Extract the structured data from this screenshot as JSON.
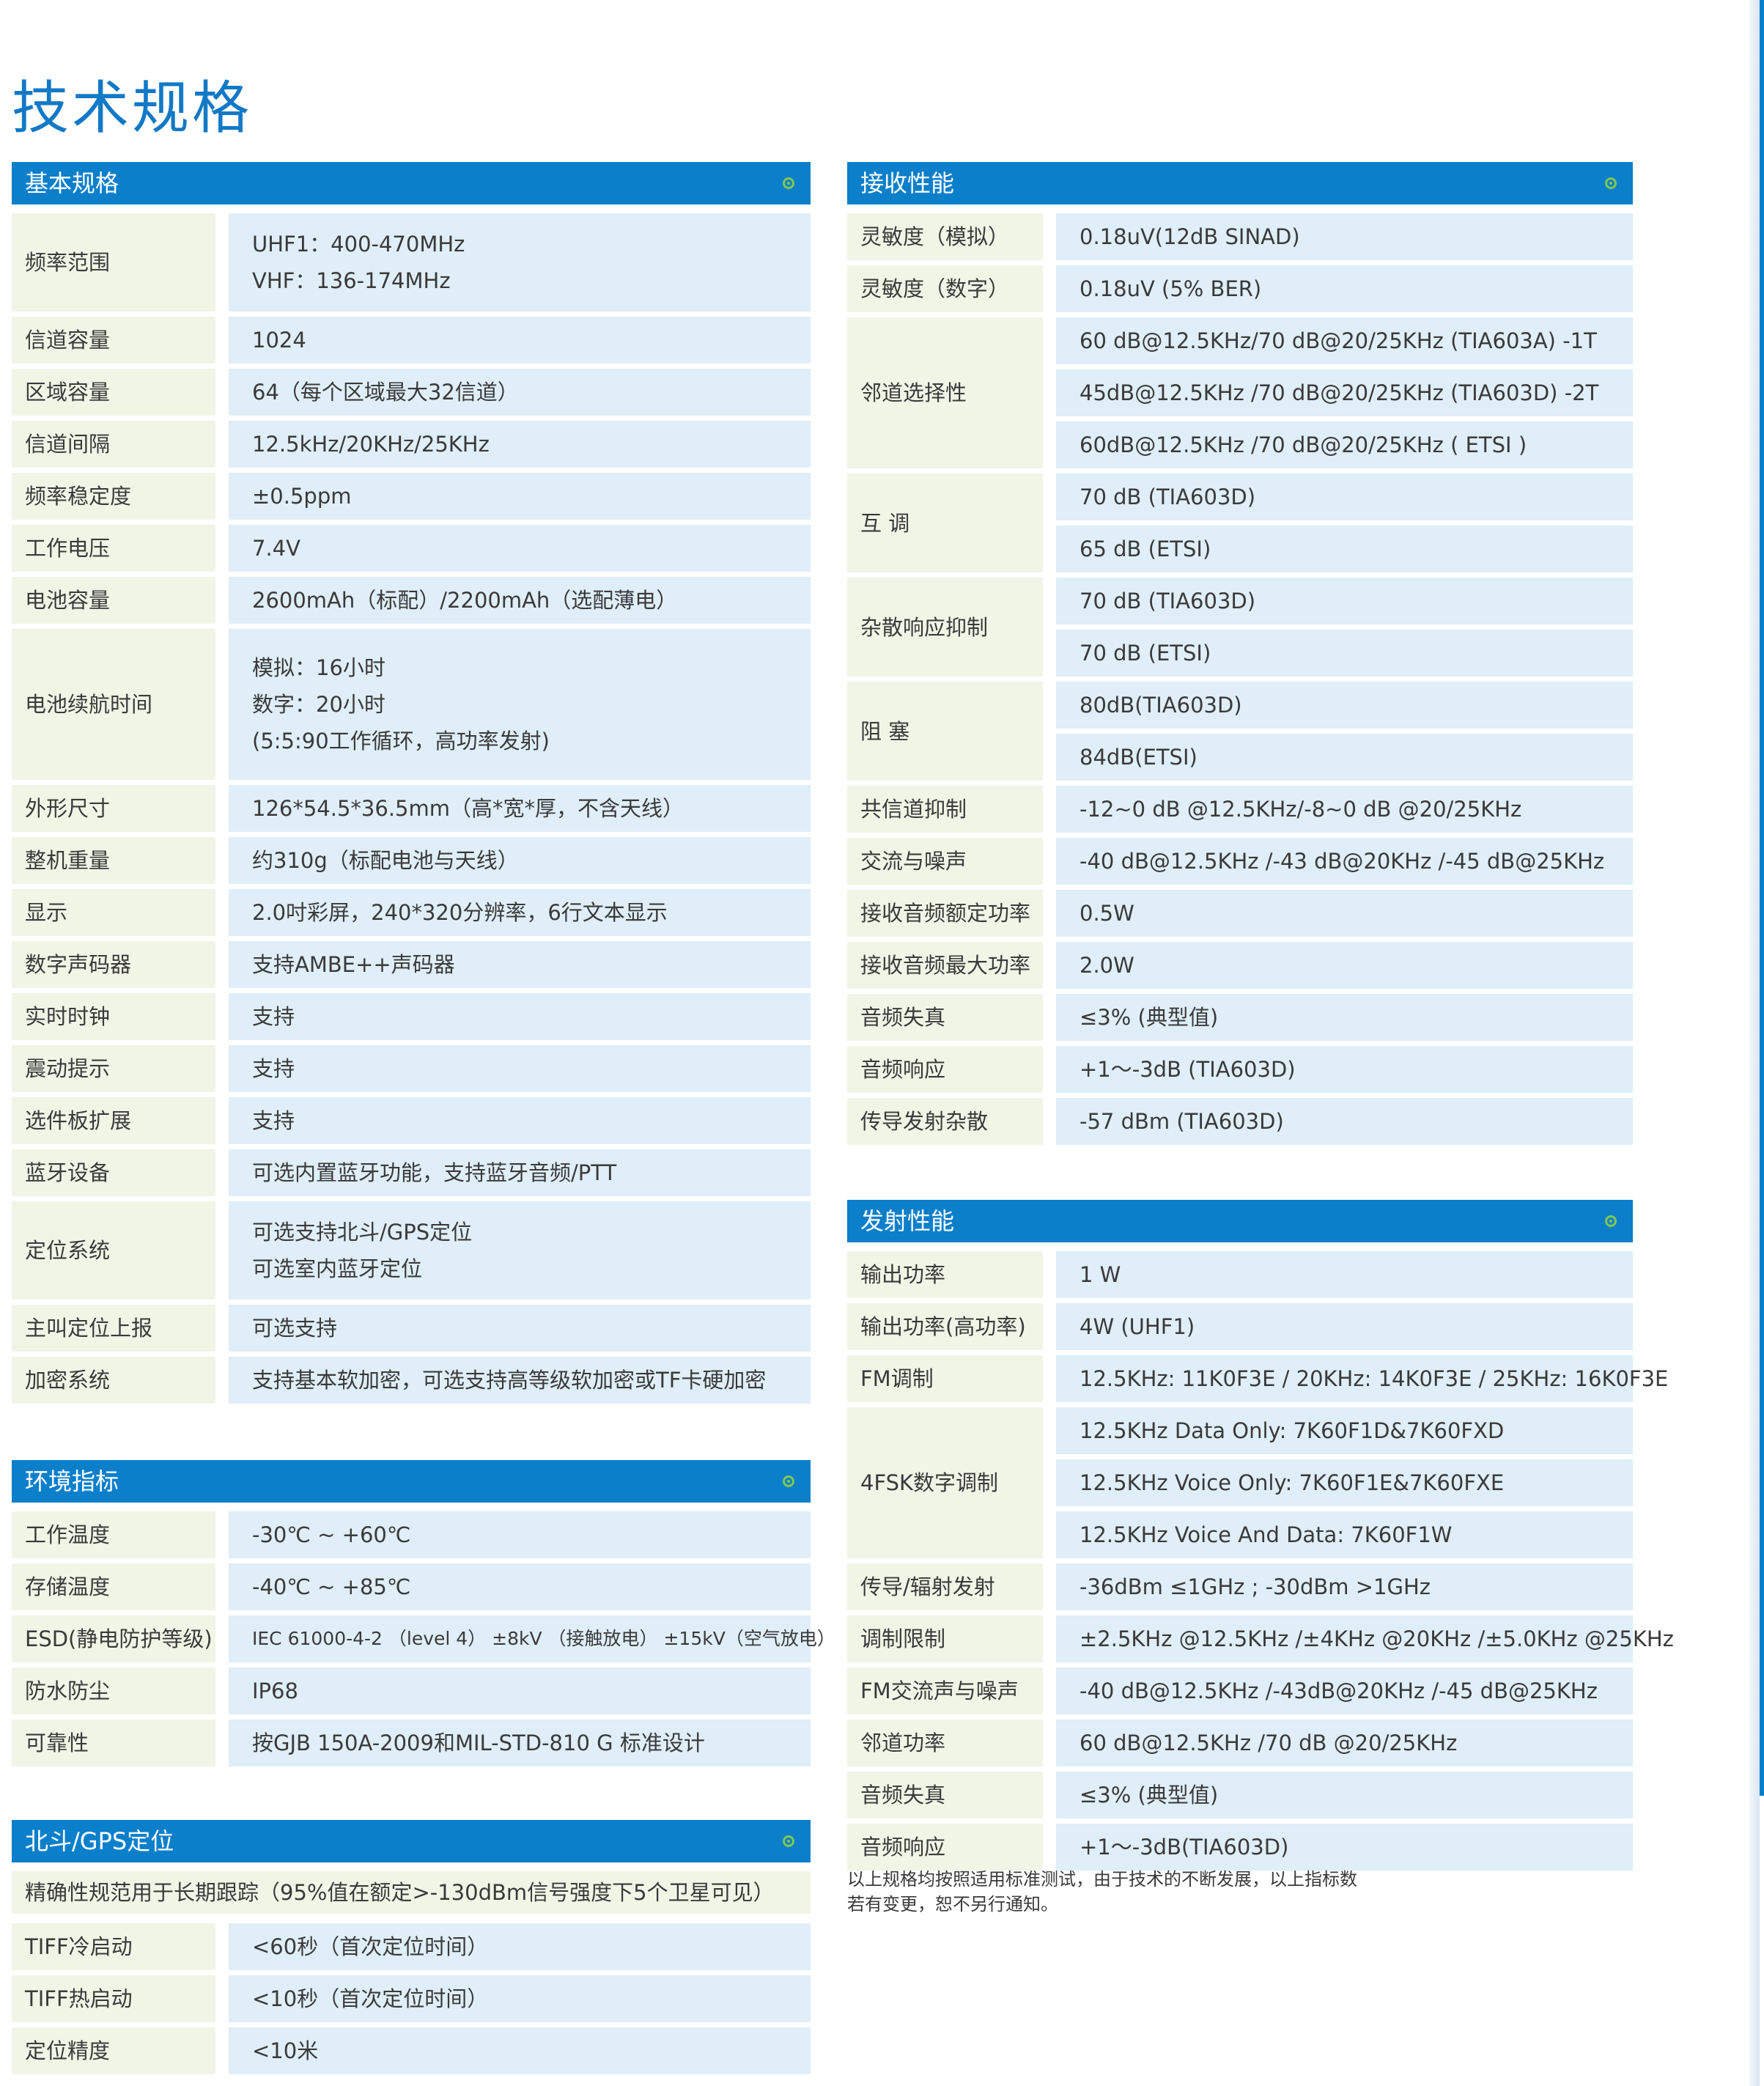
{
  "title": "技术规格",
  "colors": {
    "header": "#0c7fcb",
    "label_bg": "#f1f5e6",
    "value_bg": "#dfeef8",
    "title": "#1279c6"
  },
  "basic": {
    "heading": "基本规格",
    "rows": [
      {
        "label": "频率范围",
        "value": [
          "UHF1：400-470MHz",
          "VHF：136-174MHz"
        ]
      },
      {
        "label": "信道容量",
        "value": [
          "1024"
        ]
      },
      {
        "label": "区域容量",
        "value": [
          "64（每个区域最大32信道）"
        ]
      },
      {
        "label": "信道间隔",
        "value": [
          "12.5kHz/20KHz/25KHz"
        ]
      },
      {
        "label": "频率稳定度",
        "value": [
          "±0.5ppm"
        ]
      },
      {
        "label": "工作电压",
        "value": [
          "7.4V"
        ]
      },
      {
        "label": "电池容量",
        "value": [
          "2600mAh（标配）/2200mAh（选配薄电）"
        ]
      },
      {
        "label": "电池续航时间",
        "value": [
          "模拟：16小时",
          "数字：20小时",
          "(5:5:90工作循环，高功率发射)"
        ]
      },
      {
        "label": "外形尺寸",
        "value": [
          "126*54.5*36.5mm（高*宽*厚，不含天线）"
        ]
      },
      {
        "label": "整机重量",
        "value": [
          "约310g（标配电池与天线）"
        ]
      },
      {
        "label": "显示",
        "value": [
          "2.0吋彩屏，240*320分辨率，6行文本显示"
        ]
      },
      {
        "label": "数字声码器",
        "value": [
          "支持AMBE++声码器"
        ]
      },
      {
        "label": "实时时钟",
        "value": [
          "支持"
        ]
      },
      {
        "label": "震动提示",
        "value": [
          "支持"
        ]
      },
      {
        "label": "选件板扩展",
        "value": [
          "支持"
        ]
      },
      {
        "label": "蓝牙设备",
        "value": [
          "可选内置蓝牙功能，支持蓝牙音频/PTT"
        ]
      },
      {
        "label": "定位系统",
        "value": [
          "可选支持北斗/GPS定位",
          "可选室内蓝牙定位"
        ]
      },
      {
        "label": "主叫定位上报",
        "value": [
          "可选支持"
        ]
      },
      {
        "label": "加密系统",
        "value": [
          "支持基本软加密，可选支持高等级软加密或TF卡硬加密"
        ]
      }
    ]
  },
  "env": {
    "heading": "环境指标",
    "rows": [
      {
        "label": "工作温度",
        "value": [
          "-30℃ ~ +60℃"
        ]
      },
      {
        "label": "存储温度",
        "value": [
          "-40℃ ~ +85℃"
        ]
      },
      {
        "label": "ESD(静电防护等级)",
        "value": [
          "IEC 61000-4-2 （level 4） ±8kV （接触放电） ±15kV（空气放电）"
        ]
      },
      {
        "label": "防水防尘",
        "value": [
          "IP68"
        ]
      },
      {
        "label": "可靠性",
        "value": [
          "按GJB 150A-2009和MIL-STD-810 G 标准设计"
        ]
      }
    ]
  },
  "gps": {
    "heading": "北斗/GPS定位",
    "note": "精确性规范用于长期跟踪（95%值在额定>-130dBm信号强度下5个卫星可见）",
    "rows": [
      {
        "label": "TIFF冷启动",
        "value": [
          "<60秒（首次定位时间）"
        ]
      },
      {
        "label": "TIFF热启动",
        "value": [
          "<10秒（首次定位时间）"
        ]
      },
      {
        "label": "定位精度",
        "value": [
          "<10米"
        ]
      }
    ]
  },
  "receive": {
    "heading": "接收性能",
    "rows": [
      {
        "label": "灵敏度（模拟）",
        "value": [
          "0.18uV(12dB SINAD)"
        ]
      },
      {
        "label": "灵敏度（数字）",
        "value": [
          "0.18uV (5% BER)"
        ]
      },
      {
        "label": "邻道选择性",
        "value": [
          "60 dB@12.5KHz/70 dB@20/25KHz (TIA603A) -1T",
          "45dB@12.5KHz /70 dB@20/25KHz (TIA603D) -2T",
          "60dB@12.5KHz /70 dB@20/25KHz ( ETSI )"
        ]
      },
      {
        "label": "互 调",
        "value": [
          "70 dB (TIA603D)",
          "65 dB (ETSI)"
        ]
      },
      {
        "label": "杂散响应抑制",
        "value": [
          "70 dB (TIA603D)",
          "70 dB (ETSI)"
        ]
      },
      {
        "label": "阻 塞",
        "value": [
          "80dB(TIA603D)",
          "84dB(ETSI)"
        ]
      },
      {
        "label": "共信道抑制",
        "value": [
          "-12~0 dB @12.5KHz/-8~0 dB @20/25KHz"
        ]
      },
      {
        "label": "交流与噪声",
        "value": [
          "-40 dB@12.5KHz /-43 dB@20KHz /-45 dB@25KHz"
        ]
      },
      {
        "label": "接收音频额定功率",
        "value": [
          "0.5W"
        ]
      },
      {
        "label": "接收音频最大功率",
        "value": [
          "2.0W"
        ]
      },
      {
        "label": "音频失真",
        "value": [
          "≤3% (典型值)"
        ]
      },
      {
        "label": "音频响应",
        "value": [
          "+1～-3dB (TIA603D)"
        ]
      },
      {
        "label": "传导发射杂散",
        "value": [
          "-57 dBm (TIA603D)"
        ]
      }
    ]
  },
  "transmit": {
    "heading": "发射性能",
    "rows": [
      {
        "label": "输出功率",
        "value": [
          "1 W"
        ]
      },
      {
        "label": "输出功率(高功率)",
        "value": [
          "4W (UHF1)"
        ]
      },
      {
        "label": "FM调制",
        "value": [
          "12.5KHz: 11K0F3E / 20KHz: 14K0F3E / 25KHz: 16K0F3E"
        ]
      },
      {
        "label": "4FSK数字调制",
        "value": [
          "12.5KHz Data Only: 7K60F1D&7K60FXD",
          "12.5KHz Voice Only: 7K60F1E&7K60FXE",
          "12.5KHz Voice And Data: 7K60F1W"
        ]
      },
      {
        "label": "传导/辐射发射",
        "value": [
          "-36dBm ≤1GHz ; -30dBm >1GHz"
        ]
      },
      {
        "label": "调制限制",
        "value": [
          "±2.5KHz @12.5KHz /±4KHz @20KHz /±5.0KHz @25KHz"
        ]
      },
      {
        "label": "FM交流声与噪声",
        "value": [
          "-40 dB@12.5KHz /-43dB@20KHz /-45 dB@25KHz"
        ]
      },
      {
        "label": "邻道功率",
        "value": [
          "60 dB@12.5KHz /70 dB @20/25KHz"
        ]
      },
      {
        "label": "音频失真",
        "value": [
          "≤3% (典型值)"
        ]
      },
      {
        "label": "音频响应",
        "value": [
          "+1～-3dB(TIA603D)"
        ]
      }
    ],
    "footnote": [
      "以上规格均按照适用标准测试，由于技术的不断发展，以上指标数",
      "若有变更，恕不另行通知。"
    ]
  }
}
